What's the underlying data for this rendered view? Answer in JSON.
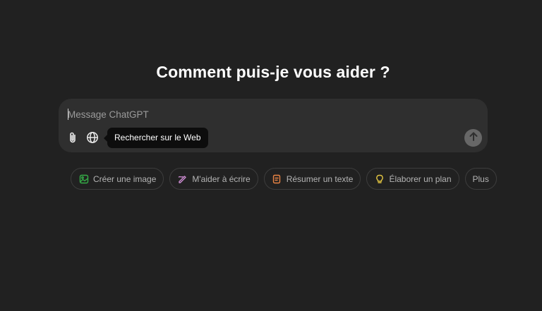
{
  "headline": "Comment puis-je vous aider ?",
  "composer": {
    "placeholder": "Message ChatGPT",
    "tooltip": "Rechercher sur le Web",
    "icons": {
      "attach": "paperclip-icon",
      "web": "globe-icon",
      "send": "arrow-up-icon"
    }
  },
  "suggestions": [
    {
      "label": "Créer une image",
      "icon": "image-icon",
      "color": "#35ae47"
    },
    {
      "label": "M'aider à écrire",
      "icon": "pen-icon",
      "color": "#cb8bd0"
    },
    {
      "label": "Résumer un texte",
      "icon": "document-icon",
      "color": "#ea8444"
    },
    {
      "label": "Élaborer un plan",
      "icon": "lightbulb-icon",
      "color": "#e2c541"
    }
  ],
  "more_label": "Plus"
}
